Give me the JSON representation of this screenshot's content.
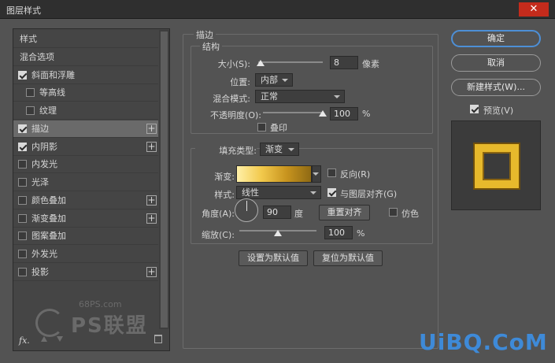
{
  "window": {
    "title": "图层样式",
    "close_glyph": "✕"
  },
  "left_panel": {
    "items": [
      {
        "label": "样式",
        "checkbox": false,
        "checked": false,
        "plus": false,
        "header": true
      },
      {
        "label": "混合选项",
        "checkbox": false,
        "checked": false,
        "plus": false,
        "header": true
      },
      {
        "label": "斜面和浮雕",
        "checkbox": true,
        "checked": true,
        "plus": false
      },
      {
        "label": "等高线",
        "checkbox": true,
        "checked": false,
        "plus": false,
        "indent": true
      },
      {
        "label": "纹理",
        "checkbox": true,
        "checked": false,
        "plus": false,
        "indent": true
      },
      {
        "label": "描边",
        "checkbox": true,
        "checked": true,
        "plus": true,
        "selected": true
      },
      {
        "label": "内阴影",
        "checkbox": true,
        "checked": true,
        "plus": true
      },
      {
        "label": "内发光",
        "checkbox": true,
        "checked": false,
        "plus": false
      },
      {
        "label": "光泽",
        "checkbox": true,
        "checked": false,
        "plus": false
      },
      {
        "label": "颜色叠加",
        "checkbox": true,
        "checked": false,
        "plus": true
      },
      {
        "label": "渐变叠加",
        "checkbox": true,
        "checked": false,
        "plus": true
      },
      {
        "label": "图案叠加",
        "checkbox": true,
        "checked": false,
        "plus": false
      },
      {
        "label": "外发光",
        "checkbox": true,
        "checked": false,
        "plus": false
      },
      {
        "label": "投影",
        "checkbox": true,
        "checked": false,
        "plus": true
      }
    ],
    "plus_glyph": "+",
    "fx_label": "fx.",
    "watermark_site": "68PS.com",
    "watermark_logo": "PS联盟"
  },
  "stroke": {
    "section_title": "描边",
    "structure_title": "结构",
    "size_label": "大小(S):",
    "size_value": "8",
    "size_unit": "像素",
    "size_fraction": 0.04,
    "position_label": "位置:",
    "position_value": "内部",
    "blend_label": "混合模式:",
    "blend_value": "正常",
    "opacity_label": "不透明度(O):",
    "opacity_value": "100",
    "opacity_unit": "%",
    "opacity_fraction": 1.0,
    "overprint_label": "叠印",
    "overprint_checked": false
  },
  "fill": {
    "fill_type_label": "填充类型:",
    "fill_type_value": "渐变",
    "gradient_label": "渐变:",
    "gradient_colors": [
      "#fff0a8",
      "#f2c94c",
      "#c8941e",
      "#8f6a14"
    ],
    "reverse_label": "反向(R)",
    "reverse_checked": false,
    "style_label": "样式:",
    "style_value": "线性",
    "align_label": "与图层对齐(G)",
    "align_checked": true,
    "angle_label": "角度(A):",
    "angle_value": "90",
    "angle_unit": "度",
    "reset_align_label": "重置对齐",
    "dither_label": "仿色",
    "dither_checked": false,
    "scale_label": "缩放(C):",
    "scale_value": "100",
    "scale_unit": "%",
    "scale_fraction": 0.5
  },
  "defaults": {
    "set_default_label": "设置为默认值",
    "reset_default_label": "复位为默认值"
  },
  "right_panel": {
    "ok_label": "确定",
    "cancel_label": "取消",
    "new_style_label": "新建样式(W)...",
    "preview_label": "预览(V)",
    "preview_checked": true
  },
  "watermark": {
    "text": "UiBQ.CoM",
    "color": "#3e8ad8"
  }
}
